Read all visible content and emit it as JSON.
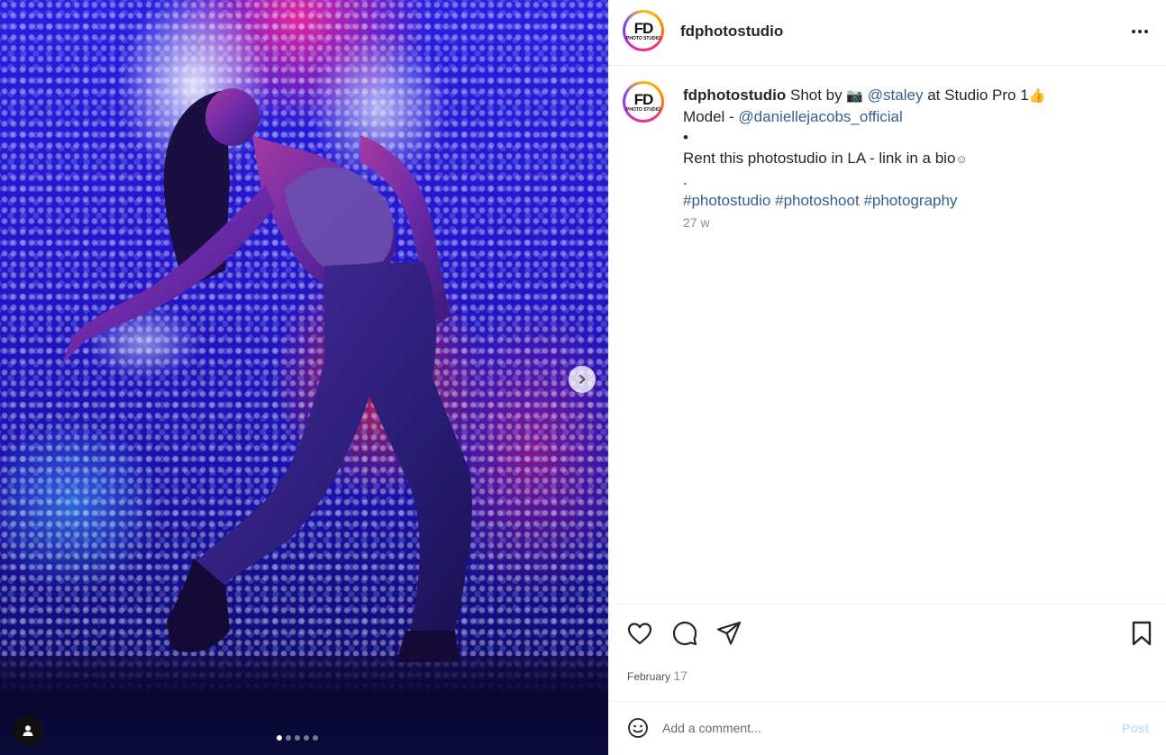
{
  "header": {
    "username": "fdphotostudio",
    "logo": {
      "initials": "FD",
      "subtitle": "PHOTO STUDIO"
    },
    "more_icon": "more-horizontal-icon"
  },
  "media": {
    "slide_count": 5,
    "active_slide": 1,
    "next_icon": "chevron-right-icon",
    "tag_icon": "user-tag-icon"
  },
  "caption": {
    "username": "fdphotostudio",
    "text_1": "Shot by",
    "camera_emoji": "📷",
    "mention_photographer": "@staley",
    "text_2": "at Studio Pro 1",
    "thumbs_emoji": "👍",
    "model_label": "Model -",
    "mention_model": "@daniellejacobs_official",
    "bullet": "•",
    "rent_text": "Rent this photostudio in LA - link in a bio",
    "smiley": "☺",
    "dot": ".",
    "hashtag_1": "#photostudio",
    "hashtag_2": "#photoshoot",
    "hashtag_3": "#photography",
    "time_ago": "27 w"
  },
  "actions": {
    "like_icon": "heart-icon",
    "comment_icon": "comment-icon",
    "share_icon": "send-icon",
    "save_icon": "bookmark-icon",
    "date_month": "February",
    "date_day": "17"
  },
  "comment": {
    "emoji_icon": "smiley-icon",
    "placeholder": "Add a comment...",
    "post_label": "Post"
  },
  "colors": {
    "link": "#385f8c",
    "post_disabled": "#c7dff7",
    "meta_gray": "#8e8e8e"
  }
}
